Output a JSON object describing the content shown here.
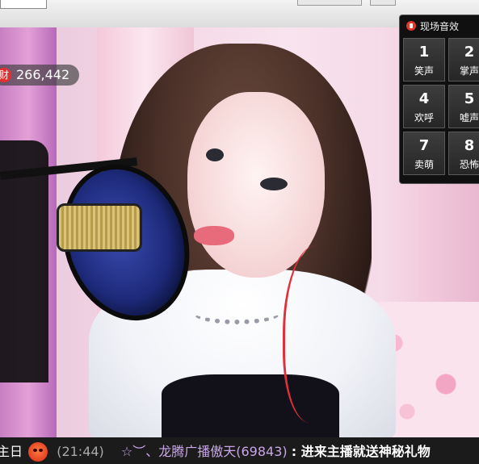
{
  "gift_counter": {
    "icon": "gift-icon",
    "icon_glyph": "财",
    "value": "266,442"
  },
  "sound_panel": {
    "title": "现场音效",
    "buttons": [
      {
        "num": "1",
        "label": "笑声"
      },
      {
        "num": "2",
        "label": "掌声"
      },
      {
        "num": "4",
        "label": "欢呼"
      },
      {
        "num": "5",
        "label": "嘘声"
      },
      {
        "num": "7",
        "label": "卖萌"
      },
      {
        "num": "8",
        "label": "恐怖"
      }
    ]
  },
  "marquee": {
    "prefix": "主日",
    "icon": "angry-face-icon",
    "time": "(21:44)",
    "user": "☆︶、龙腾广播傲天(69843)",
    "message": ": 进来主播就送神秘礼物"
  },
  "colors": {
    "accent_red": "#e3302f",
    "panel_bg": "#101010",
    "marquee_user": "#c9a6e8"
  }
}
